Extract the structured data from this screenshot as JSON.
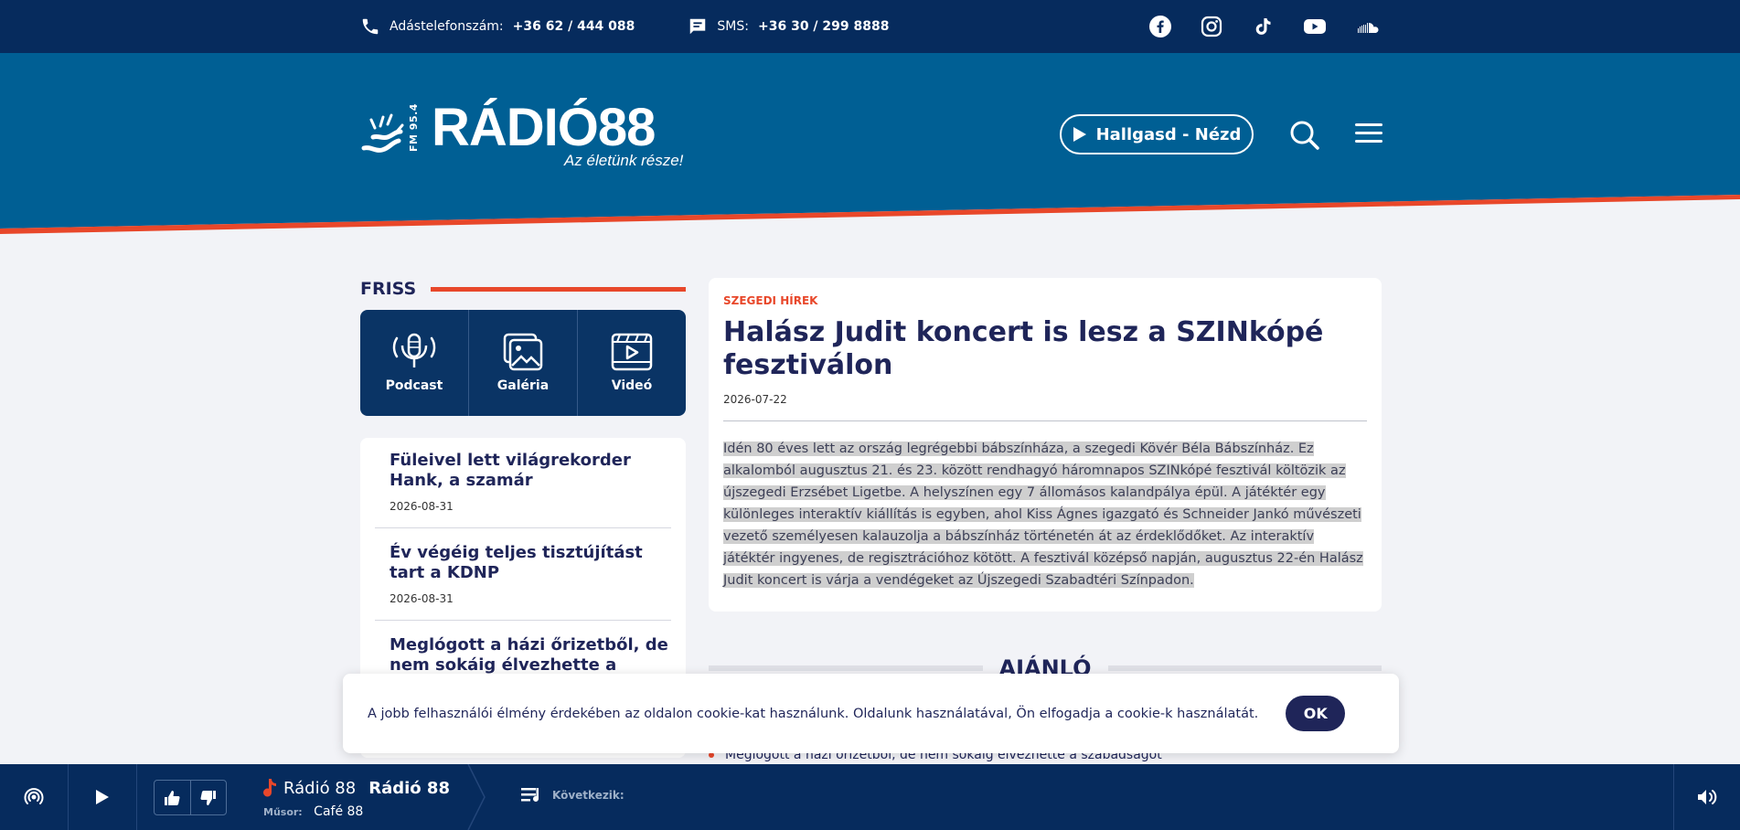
{
  "topbar": {
    "phone_label": "Adástelefonszám:",
    "phone_number": "+36 62 / 444 088",
    "sms_label": "SMS:",
    "sms_number": "+36 30 / 299 8888",
    "socials": [
      "facebook-icon",
      "instagram-icon",
      "tiktok-icon",
      "youtube-icon",
      "soundcloud-icon"
    ]
  },
  "header": {
    "logo_fm": "FM 95.4",
    "logo_name": "RÁDIÓ88",
    "logo_slogan": "Az életünk része!",
    "listen_label": "Hallgasd - Nézd"
  },
  "sidebar": {
    "section_title": "FRISS",
    "media": [
      {
        "label": "Podcast",
        "icon": "podcast-icon"
      },
      {
        "label": "Galéria",
        "icon": "gallery-icon"
      },
      {
        "label": "Videó",
        "icon": "video-icon"
      }
    ],
    "news": [
      {
        "title": "Füleivel lett világrekorder Hank, a szamár",
        "date": "2026-08-31"
      },
      {
        "title": "Év végéig teljes tisztújítást tart a KDNP",
        "date": "2026-08-31"
      },
      {
        "title": "Meglógott a házi őrizetből, de nem sokáig élvezhette a",
        "date": ""
      }
    ]
  },
  "article": {
    "category": "SZEGEDI HÍREK",
    "title": "Halász Judit koncert is lesz a SZINkópé fesztiválon",
    "date": "2026-07-22",
    "body": "Idén 80 éves lett az ország legrégebbi bábszínháza, a szegedi Kövér Béla Bábszínház. Ez alkalomból augusztus 21. és 23. között rendhagyó háromnapos SZINkópé fesztivál költözik az újszegedi Erzsébet Ligetbe. A helyszínen egy 7 állomásos kalandpálya épül. A játéktér egy különleges interaktív kiállítás is egyben, ahol Kiss Ágnes igazgató és Schneider Jankó művészeti vezető személyesen kalauzolja a bábszínház történetén át az érdeklődőket. Az interaktív játéktér ingyenes, de regisztrációhoz kötött. A fesztivál középső napján, augusztus 22-én Halász Judit koncert is várja a vendégeket az Újszegedi Szabadtéri Színpadon."
  },
  "recommend": {
    "title": "AJÁNLÓ",
    "items": [
      "Meglógott a házi őrizetből, de nem sokáig élvezhette a szabadságot"
    ]
  },
  "cookie": {
    "text": "A jobb felhasználói élmény érdekében az oldalon cookie-kat használunk. Oldalunk használatával, Ön elfogadja a cookie-k használatát.",
    "ok_label": "OK"
  },
  "player": {
    "station_name": "Rádió 88",
    "station_title": "Rádió 88",
    "show_label": "Műsor:",
    "show_name": "Café 88",
    "next_label": "Következik:"
  },
  "colors": {
    "navy": "#062b5d",
    "header_blue": "#005f94",
    "accent_red": "#e8472a",
    "text_dark": "#1f2559"
  }
}
